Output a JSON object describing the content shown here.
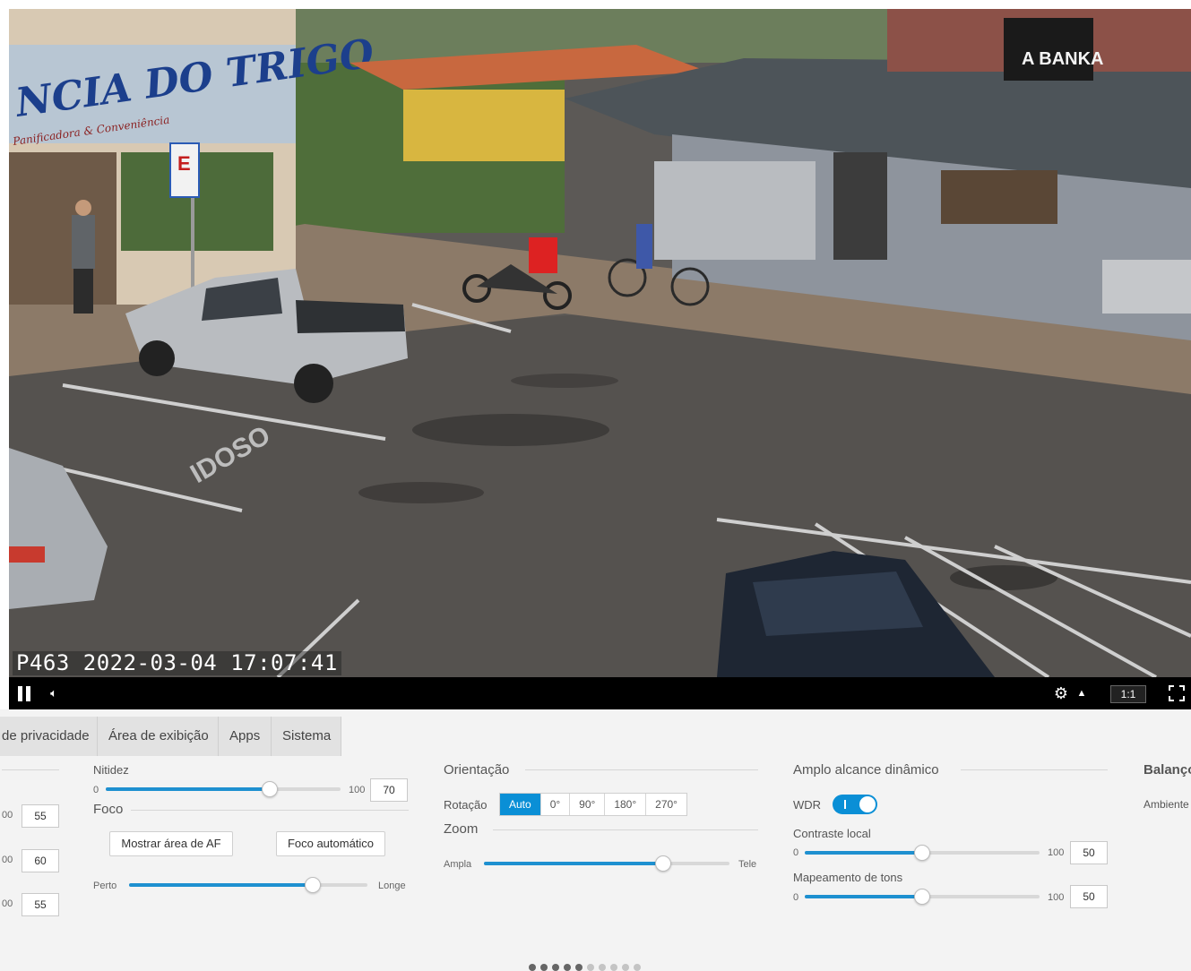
{
  "viewer": {
    "overlay_text": "P463 2022-03-04 17:07:41",
    "scene": {
      "sign_left": "NCIA DO TRIGO",
      "sign_left_sub": "Panificadora & Conveniência",
      "sign_right": "A BANKA",
      "parking_marking": "IDOSO",
      "parking_sign": "E"
    },
    "controls": {
      "pause_icon": "pause-icon",
      "volume_icon": "volume-icon",
      "stream_icon": "stream-profile-icon",
      "caret_icon": "chevron-up-icon",
      "ratio_label": "1:1",
      "fullscreen_icon": "fullscreen-icon"
    }
  },
  "tabs": [
    "de privacidade",
    "Área de exibição",
    "Apps",
    "Sistema"
  ],
  "left_column": {
    "values": [
      "55",
      "60",
      "55"
    ],
    "max_label": "00"
  },
  "image_column": {
    "sharpness": {
      "label": "Nitidez",
      "min": "0",
      "max": "100",
      "value": "70",
      "fraction": 0.7
    },
    "focus": {
      "title": "Foco",
      "show_af_button": "Mostrar área de AF",
      "auto_focus_button": "Foco automático",
      "near_label": "Perto",
      "far_label": "Longe",
      "fraction": 0.77
    }
  },
  "orientation_column": {
    "title": "Orientação",
    "rotation_label": "Rotação",
    "rotation_options": [
      "Auto",
      "0°",
      "90°",
      "180°",
      "270°"
    ],
    "rotation_selected": "Auto",
    "zoom": {
      "title": "Zoom",
      "wide_label": "Ampla",
      "tele_label": "Tele",
      "fraction": 0.73
    }
  },
  "wdr_column": {
    "title": "Amplo alcance dinâmico",
    "wdr_label": "WDR",
    "wdr_on": true,
    "local_contrast": {
      "label": "Contraste local",
      "min": "0",
      "max": "100",
      "value": "50",
      "fraction": 0.5
    },
    "tone_mapping": {
      "label": "Mapeamento de tons",
      "min": "0",
      "max": "100",
      "value": "50",
      "fraction": 0.5
    }
  },
  "balance_column": {
    "title": "Balanço",
    "ambient_label": "Ambiente"
  },
  "pagination": {
    "total": 10,
    "active": 5
  },
  "colors": {
    "accent": "#0a8fd6",
    "slider_fill": "#1e90d0"
  }
}
